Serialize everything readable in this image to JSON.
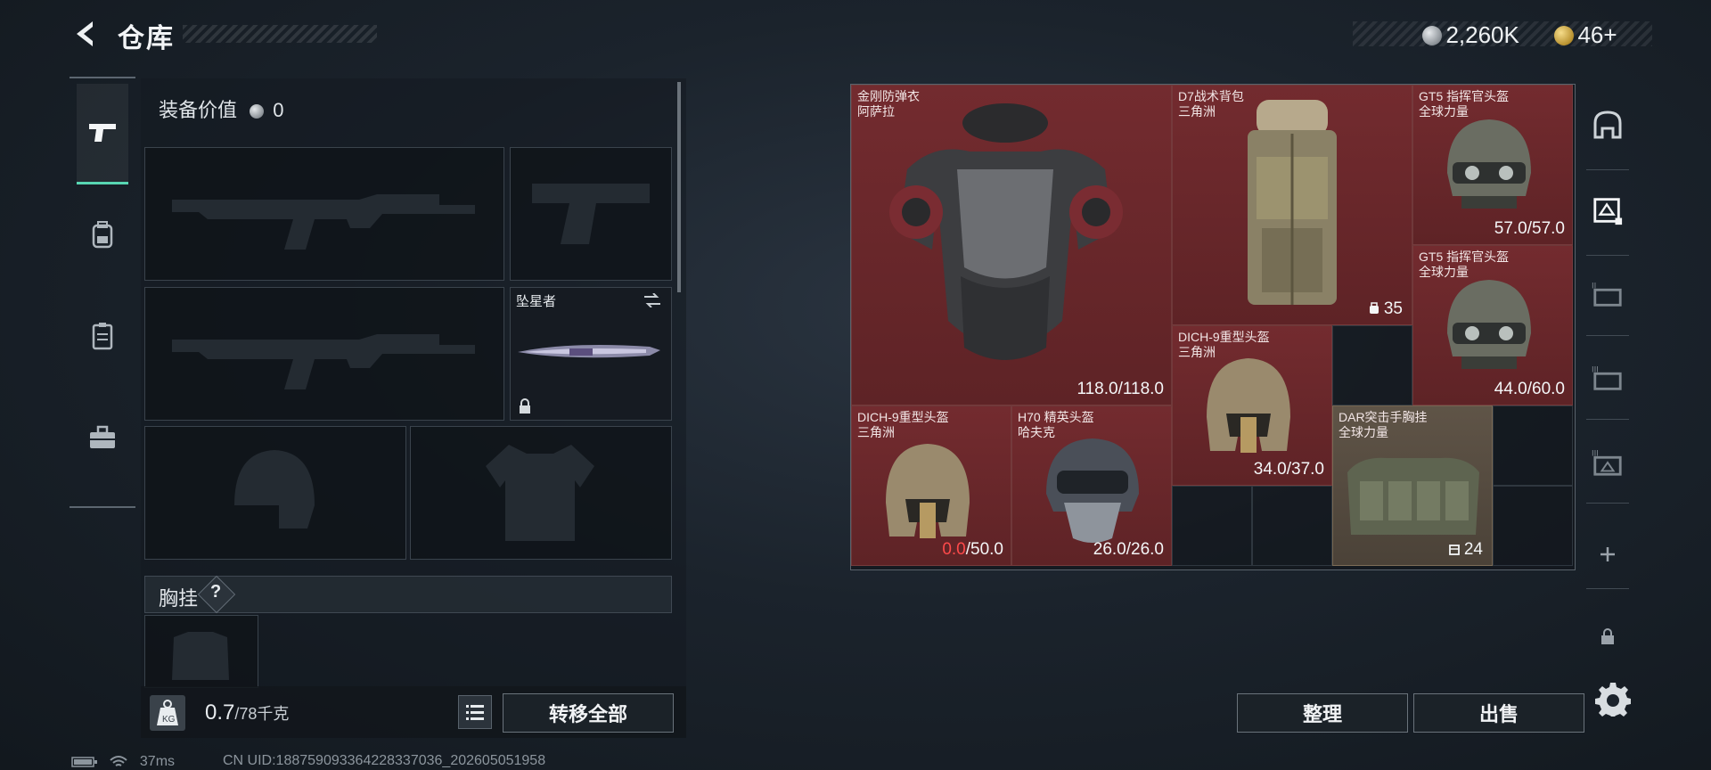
{
  "header": {
    "title": "仓库",
    "currency_silver": "2,260K",
    "currency_gold": "46+"
  },
  "equipment": {
    "value_label": "装备价值",
    "value": "0",
    "melee_name": "坠星者",
    "chest_label": "胸挂",
    "help_mark": "?",
    "weight": "0.7",
    "weight_cap": "/78千克",
    "transfer_all": "转移全部"
  },
  "storage": {
    "items": [
      {
        "name1": "金刚防弹衣",
        "name2": "阿萨拉",
        "value": "118.0/118.0"
      },
      {
        "name1": "D7战术背包",
        "name2": "三角洲",
        "count": "35"
      },
      {
        "name1": "GT5 指挥官头盔",
        "name2": "全球力量",
        "value": "57.0/57.0"
      },
      {
        "name1": "GT5 指挥官头盔",
        "name2": "全球力量",
        "value": "44.0/60.0"
      },
      {
        "name1": "DICH-9重型头盔",
        "name2": "三角洲",
        "value": "34.0/37.0"
      },
      {
        "name1": "DICH-9重型头盔",
        "name2": "三角洲",
        "value_zero": "0.0",
        "value_rest": "/50.0"
      },
      {
        "name1": "H70 精英头盔",
        "name2": "哈夫克",
        "value": "26.0/26.0"
      },
      {
        "name1": "DAR突击手胸挂",
        "name2": "全球力量",
        "count": "24"
      }
    ]
  },
  "actions": {
    "sort": "整理",
    "sell": "出售"
  },
  "footer": {
    "ping": "37ms",
    "uid": "CN UID:188759093364228337036_202605051958"
  },
  "colors": {
    "accent": "#58d6b2",
    "item_red": "#6e2a2d",
    "item_tan": "#5f5447",
    "durability_zero": "#ff4a4a"
  }
}
